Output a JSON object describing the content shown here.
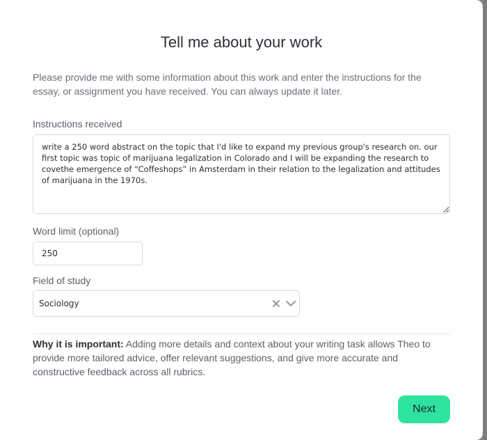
{
  "modal": {
    "title": "Tell me about your work",
    "intro": "Please provide me with some information about this work and enter the instructions for the essay, or assignment you have received. You can always update it later."
  },
  "instructions": {
    "label": "Instructions received",
    "value": "write a 250 word abstract on the topic that I'd like to expand my previous group's research on. our first topic was topic of marijuana legalization in Colorado and I will be expanding the research to covethe emergence of “Coffeshops” in Amsterdam in their relation to the legalization and attitudes of marijuana in the 1970s."
  },
  "word_limit": {
    "label": "Word limit (optional)",
    "value": "250"
  },
  "field_of_study": {
    "label": "Field of study",
    "selected": "Sociology"
  },
  "why": {
    "heading": "Why it is important:",
    "text": " Adding more details and context about your writing task allows Theo to provide more tailored advice, offer relevant suggestions, and give more accurate and constructive feedback across all rubrics."
  },
  "actions": {
    "next_label": "Next"
  },
  "colors": {
    "accent": "#2de39f",
    "title": "#2b2f36",
    "muted": "#6b6f76"
  }
}
